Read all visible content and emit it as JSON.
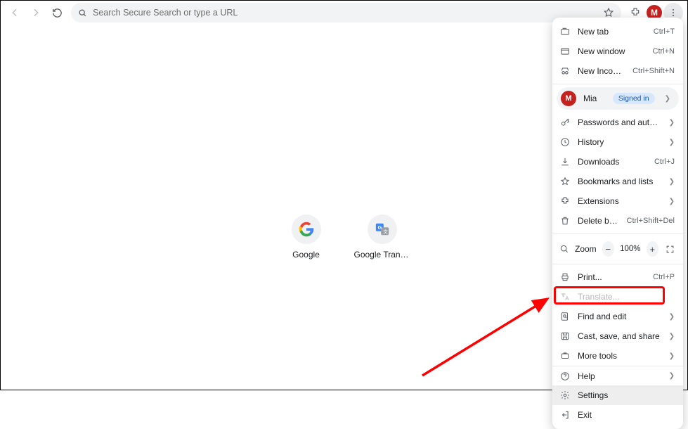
{
  "toolbar": {
    "placeholder": "Search Secure Search or type a URL",
    "avatar_initial": "M"
  },
  "shortcuts": [
    {
      "label": "Google"
    },
    {
      "label": "Google Transl..."
    }
  ],
  "menu": {
    "new_tab": "New tab",
    "new_tab_sc": "Ctrl+T",
    "new_window": "New window",
    "new_window_sc": "Ctrl+N",
    "incognito": "New Incognito window",
    "incognito_sc": "Ctrl+Shift+N",
    "profile_name": "Mia",
    "profile_badge": "Signed in",
    "profile_initial": "M",
    "passwords": "Passwords and autofill",
    "history": "History",
    "downloads": "Downloads",
    "downloads_sc": "Ctrl+J",
    "bookmarks": "Bookmarks and lists",
    "extensions": "Extensions",
    "delete": "Delete browsing data...",
    "delete_sc": "Ctrl+Shift+Del",
    "zoom": "Zoom",
    "zoom_val": "100%",
    "print": "Print...",
    "print_sc": "Ctrl+P",
    "translate": "Translate...",
    "find": "Find and edit",
    "cast": "Cast, save, and share",
    "more_tools": "More tools",
    "help": "Help",
    "settings": "Settings",
    "exit": "Exit"
  }
}
